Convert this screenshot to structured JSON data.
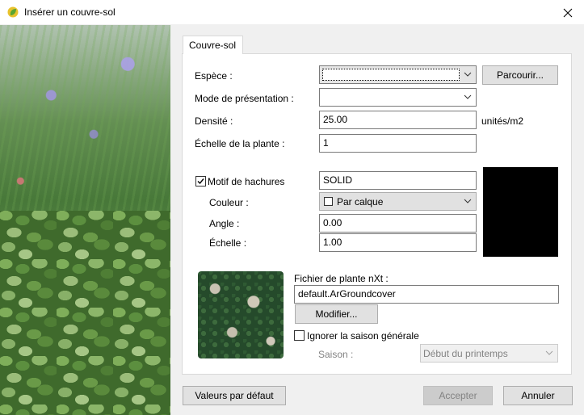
{
  "window": {
    "title": "Insérer un couvre-sol",
    "close_icon": "close-icon"
  },
  "tab": {
    "label": "Couvre-sol"
  },
  "form": {
    "espece_label": "Espèce :",
    "espece_value": "",
    "parcourir_label": "Parcourir...",
    "mode_label": "Mode de présentation :",
    "mode_value": "",
    "densite_label": "Densité :",
    "densite_value": "25.00",
    "densite_unit": "unités/m2",
    "echelle_plante_label": "Échelle de la plante :",
    "echelle_plante_value": "1"
  },
  "hatch": {
    "checked": true,
    "motif_label": "Motif de hachures",
    "motif_value": "SOLID",
    "couleur_label": "Couleur :",
    "couleur_value": "Par calque",
    "angle_label": "Angle :",
    "angle_value": "0.00",
    "echelle_label": "Échelle :",
    "echelle_value": "1.00",
    "preview_color": "#000000"
  },
  "plant_file": {
    "label": "Fichier de plante nXt :",
    "value": "default.ArGroundcover",
    "modifier_label": "Modifier...",
    "ignore_checked": false,
    "ignore_label": "Ignorer la saison générale",
    "saison_label": "Saison :",
    "saison_value": "Début du printemps"
  },
  "footer": {
    "defaults_label": "Valeurs par défaut",
    "accept_label": "Accepter",
    "cancel_label": "Annuler"
  }
}
